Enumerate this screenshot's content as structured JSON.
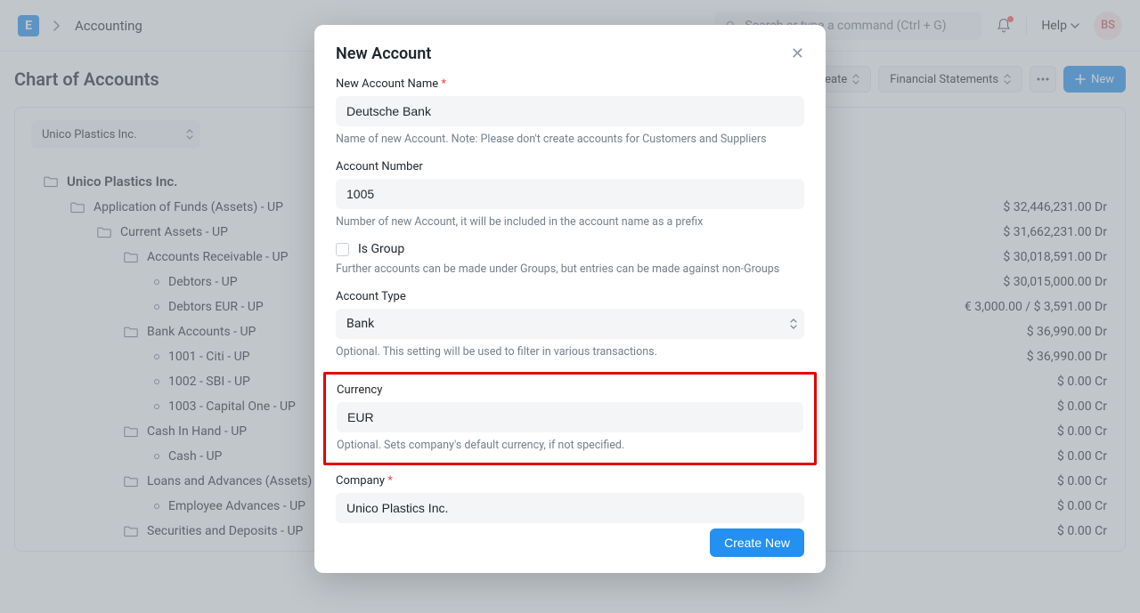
{
  "topbar": {
    "logo_letter": "E",
    "breadcrumb": "Accounting",
    "search_placeholder": "Search or type a command (Ctrl + G)",
    "help_label": "Help",
    "avatar_initials": "BS"
  },
  "page": {
    "title": "Chart of Accounts",
    "btn_create": "Create",
    "btn_financial": "Financial Statements",
    "btn_new": "New"
  },
  "company_select": "Unico Plastics Inc.",
  "tree": [
    {
      "indent": 0,
      "type": "folder",
      "bold": true,
      "label": "Unico Plastics Inc.",
      "amount": ""
    },
    {
      "indent": 1,
      "type": "folder",
      "label": "Application of Funds (Assets) - UP",
      "amount": "$ 32,446,231.00 Dr"
    },
    {
      "indent": 2,
      "type": "folder",
      "label": "Current Assets - UP",
      "amount": "$ 31,662,231.00 Dr"
    },
    {
      "indent": 3,
      "type": "folder",
      "label": "Accounts Receivable - UP",
      "amount": "$ 30,018,591.00 Dr"
    },
    {
      "indent": 4,
      "type": "leaf",
      "label": "Debtors - UP",
      "amount": "$ 30,015,000.00 Dr"
    },
    {
      "indent": 4,
      "type": "leaf",
      "label": "Debtors EUR - UP",
      "amount": "€ 3,000.00 / $ 3,591.00 Dr"
    },
    {
      "indent": 3,
      "type": "folder",
      "label": "Bank Accounts - UP",
      "amount": "$ 36,990.00 Dr"
    },
    {
      "indent": 4,
      "type": "leaf",
      "label": "1001 - Citi - UP",
      "amount": "$ 36,990.00 Dr"
    },
    {
      "indent": 4,
      "type": "leaf",
      "label": "1002 - SBI - UP",
      "amount": "$ 0.00 Cr"
    },
    {
      "indent": 4,
      "type": "leaf",
      "label": "1003 - Capital One - UP",
      "amount": "$ 0.00 Cr"
    },
    {
      "indent": 3,
      "type": "folder",
      "label": "Cash In Hand - UP",
      "amount": "$ 0.00 Cr"
    },
    {
      "indent": 4,
      "type": "leaf",
      "label": "Cash - UP",
      "amount": "$ 0.00 Cr"
    },
    {
      "indent": 3,
      "type": "folder",
      "label": "Loans and Advances (Assets) - UP",
      "amount": "$ 0.00 Cr"
    },
    {
      "indent": 4,
      "type": "leaf",
      "label": "Employee Advances - UP",
      "amount": "$ 0.00 Cr"
    },
    {
      "indent": 3,
      "type": "folder",
      "label": "Securities and Deposits - UP",
      "amount": "$ 0.00 Cr"
    }
  ],
  "modal": {
    "title": "New Account",
    "name_label": "New Account Name",
    "name_value": "Deutsche Bank",
    "name_help": "Name of new Account. Note: Please don't create accounts for Customers and Suppliers",
    "number_label": "Account Number",
    "number_value": "1005",
    "number_help": "Number of new Account, it will be included in the account name as a prefix",
    "isgroup_label": "Is Group",
    "isgroup_help": "Further accounts can be made under Groups, but entries can be made against non-Groups",
    "type_label": "Account Type",
    "type_value": "Bank",
    "type_help": "Optional. This setting will be used to filter in various transactions.",
    "currency_label": "Currency",
    "currency_value": "EUR",
    "currency_help": "Optional. Sets company's default currency, if not specified.",
    "company_label": "Company",
    "company_value": "Unico Plastics Inc.",
    "create_btn": "Create New"
  }
}
